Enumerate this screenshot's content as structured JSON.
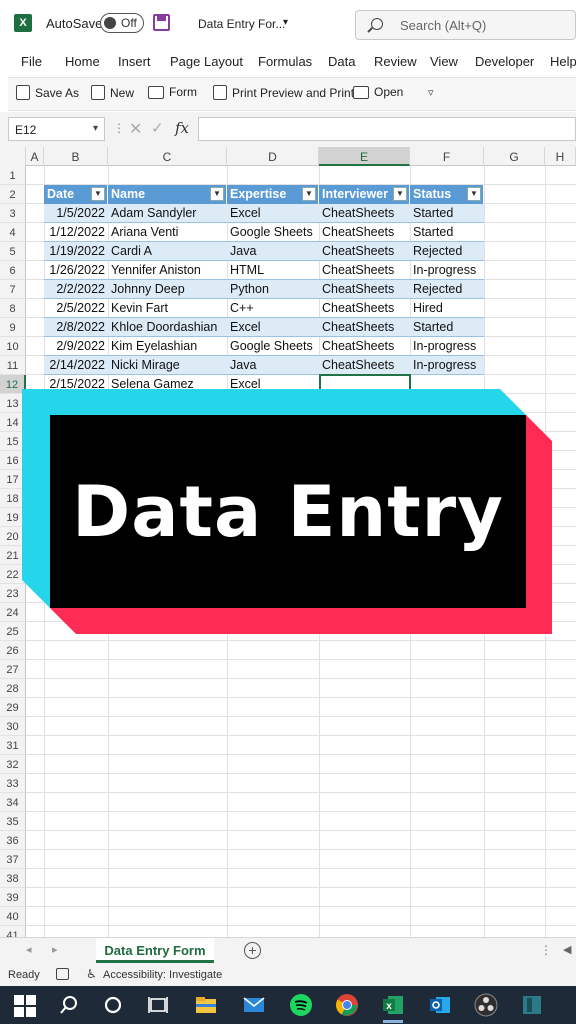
{
  "titlebar": {
    "app_logo": "X",
    "autosave_label": "AutoSave",
    "autosave_state": "Off",
    "doc_title": "Data Entry For...",
    "search_placeholder": "Search (Alt+Q)"
  },
  "menu": [
    "File",
    "Home",
    "Insert",
    "Page Layout",
    "Formulas",
    "Data",
    "Review",
    "View",
    "Developer",
    "Help"
  ],
  "toolbar": {
    "save_as": "Save As",
    "new": "New",
    "form": "Form",
    "print": "Print Preview and Print",
    "open": "Open"
  },
  "formula_bar": {
    "name_box": "E12",
    "fx": "fx",
    "content": ""
  },
  "columns": [
    "A",
    "B",
    "C",
    "D",
    "E",
    "F",
    "G",
    "H"
  ],
  "selected_column": "E",
  "selected_row": "12",
  "rows": [
    "1",
    "2",
    "3",
    "4",
    "5",
    "6",
    "7",
    "8",
    "9",
    "10",
    "11",
    "12",
    "13",
    "14",
    "15",
    "16",
    "17",
    "18",
    "19",
    "20",
    "21",
    "22",
    "23",
    "24",
    "25",
    "26",
    "27",
    "28",
    "29",
    "30",
    "31",
    "32",
    "33",
    "34",
    "35",
    "36",
    "37",
    "38",
    "39",
    "40",
    "41"
  ],
  "table": {
    "headers": [
      "Date",
      "Name",
      "Expertise",
      "Interviewer",
      "Status"
    ],
    "rows": [
      [
        "1/5/2022",
        "Adam Sandyler",
        "Excel",
        "CheatSheets",
        "Started"
      ],
      [
        "1/12/2022",
        "Ariana Venti",
        "Google Sheets",
        "CheatSheets",
        "Started"
      ],
      [
        "1/19/2022",
        "Cardi A",
        "Java",
        "CheatSheets",
        "Rejected"
      ],
      [
        "1/26/2022",
        "Yennifer Aniston",
        "HTML",
        "CheatSheets",
        "In-progress"
      ],
      [
        "2/2/2022",
        "Johnny Deep",
        "Python",
        "CheatSheets",
        "Rejected"
      ],
      [
        "2/5/2022",
        "Kevin Fart",
        "C++",
        "CheatSheets",
        "Hired"
      ],
      [
        "2/8/2022",
        "Khloe Doordashian",
        "Excel",
        "CheatSheets",
        "Started"
      ],
      [
        "2/9/2022",
        "Kim Eyelashian",
        "Google Sheets",
        "CheatSheets",
        "In-progress"
      ],
      [
        "2/14/2022",
        "Nicki Mirage",
        "Java",
        "CheatSheets",
        "In-progress"
      ],
      [
        "2/15/2022",
        "Selena Gamez",
        "Excel",
        "",
        ""
      ]
    ]
  },
  "banner": {
    "text": "Data Entry",
    "colors": {
      "cyan": "#25d5ea",
      "red": "#fe2c55",
      "black": "#000000"
    }
  },
  "sheet_tab": "Data Entry Form",
  "status": {
    "ready": "Ready",
    "accessibility": "Accessibility: Investigate"
  },
  "taskbar_icons": [
    "windows-start-icon",
    "search-icon",
    "cortana-icon",
    "task-view-icon",
    "file-explorer-icon",
    "mail-icon",
    "spotify-icon",
    "chrome-icon",
    "excel-icon",
    "outlook-icon",
    "obs-icon",
    "app-icon"
  ],
  "accent_color": "#217346"
}
